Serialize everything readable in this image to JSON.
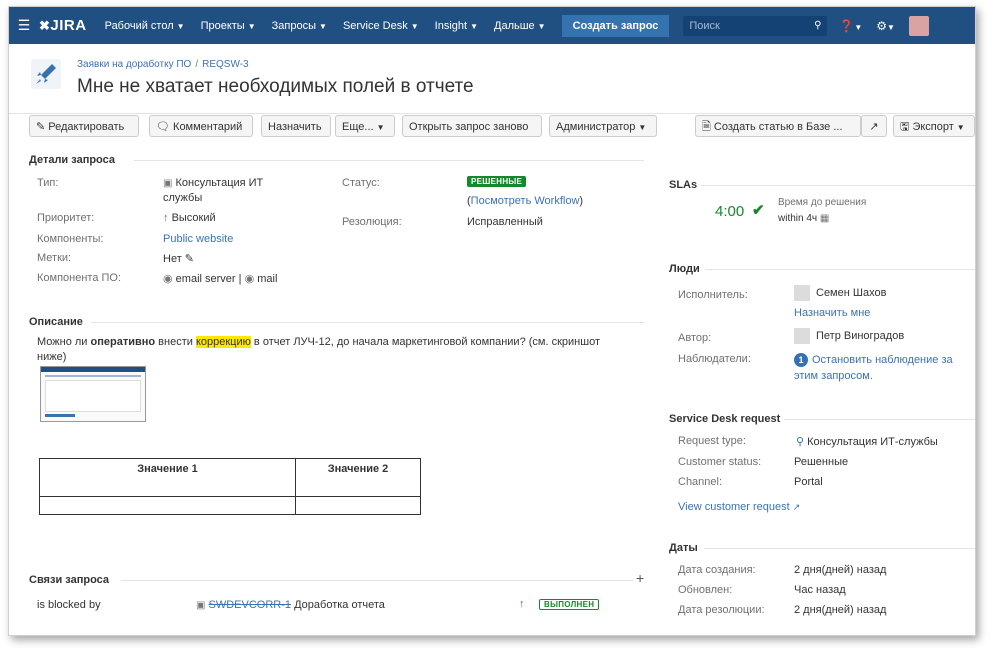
{
  "topnav": {
    "logo": "JIRA",
    "items": [
      "Рабочий стол",
      "Проекты",
      "Запросы",
      "Service Desk",
      "Insight",
      "Дальше"
    ],
    "create": "Создать запрос",
    "search_placeholder": "Поиск"
  },
  "header": {
    "breadcrumb_project": "Заявки на доработку ПО",
    "breadcrumb_key": "REQSW-3",
    "title": "Мне не хватает необходимых полей в отчете"
  },
  "toolbar": {
    "edit": "Редактировать",
    "comment": "Комментарий",
    "assign": "Назначить",
    "more": "Еще...",
    "reopen": "Открыть запрос заново",
    "admin": "Администратор",
    "kb": "Создать статью в Базе ...",
    "export": "Экспорт"
  },
  "details": {
    "title": "Детали запроса",
    "type_label": "Тип:",
    "type_value_1": "Консультация ИТ",
    "type_value_2": "службы",
    "priority_label": "Приоритет:",
    "priority_value": "Высокий",
    "components_label": "Компоненты:",
    "components_value": "Public website",
    "labels_label": "Метки:",
    "labels_value": "Нет",
    "sw_component_label": "Компонента ПО:",
    "sw_component_1": "email server",
    "sw_component_sep": "|",
    "sw_component_2": "mail",
    "status_label": "Статус:",
    "status_value": "РЕШЕННЫЕ",
    "workflow_open": "(",
    "workflow_link": "Посмотреть Workflow",
    "workflow_close": ")",
    "resolution_label": "Резолюция:",
    "resolution_value": "Исправленный"
  },
  "description": {
    "title": "Описание",
    "p1": "Можно ли ",
    "p2": "оперативно",
    "p3": " внести ",
    "p4": "коррекцию",
    "p5": " в отчет ЛУЧ-12, до начала маркетинговой компании? (см. скриншот",
    "p6": "ниже)",
    "table_headers": [
      "Значение 1",
      "Значение 2"
    ]
  },
  "links": {
    "title": "Связи запроса",
    "add": "+",
    "relation": "is blocked by",
    "issue_key": "SWDEVCORR-1",
    "issue_summary": "Доработка отчета",
    "issue_status": "ВЫПОЛНЕН"
  },
  "sla": {
    "title": "SLAs",
    "time": "4:00",
    "name": "Время до решения",
    "goal": "within 4ч"
  },
  "people": {
    "title": "Люди",
    "assignee_label": "Исполнитель:",
    "assignee": "Семен Шахов",
    "assign_me": "Назначить мне",
    "reporter_label": "Автор:",
    "reporter": "Петр Виноградов",
    "watchers_label": "Наблюдатели:",
    "watchers_count": "1",
    "watch_text_1": "Остановить наблюдение за",
    "watch_text_2": "этим запросом."
  },
  "sd": {
    "title": "Service Desk request",
    "type_label": "Request type:",
    "type_value": "Консультация ИТ-службы",
    "cust_status_label": "Customer status:",
    "cust_status": "Решенные",
    "channel_label": "Channel:",
    "channel": "Portal",
    "view_link": "View customer request"
  },
  "dates": {
    "title": "Даты",
    "created_label": "Дата создания:",
    "created": "2 дня(дней) назад",
    "updated_label": "Обновлен:",
    "updated": "Час назад",
    "resolved_label": "Дата резолюции:",
    "resolved": "2 дня(дней) назад"
  },
  "colors": {
    "nav": "#205081",
    "link": "#3b73af",
    "green": "#14892c",
    "priority": "#d04437"
  }
}
